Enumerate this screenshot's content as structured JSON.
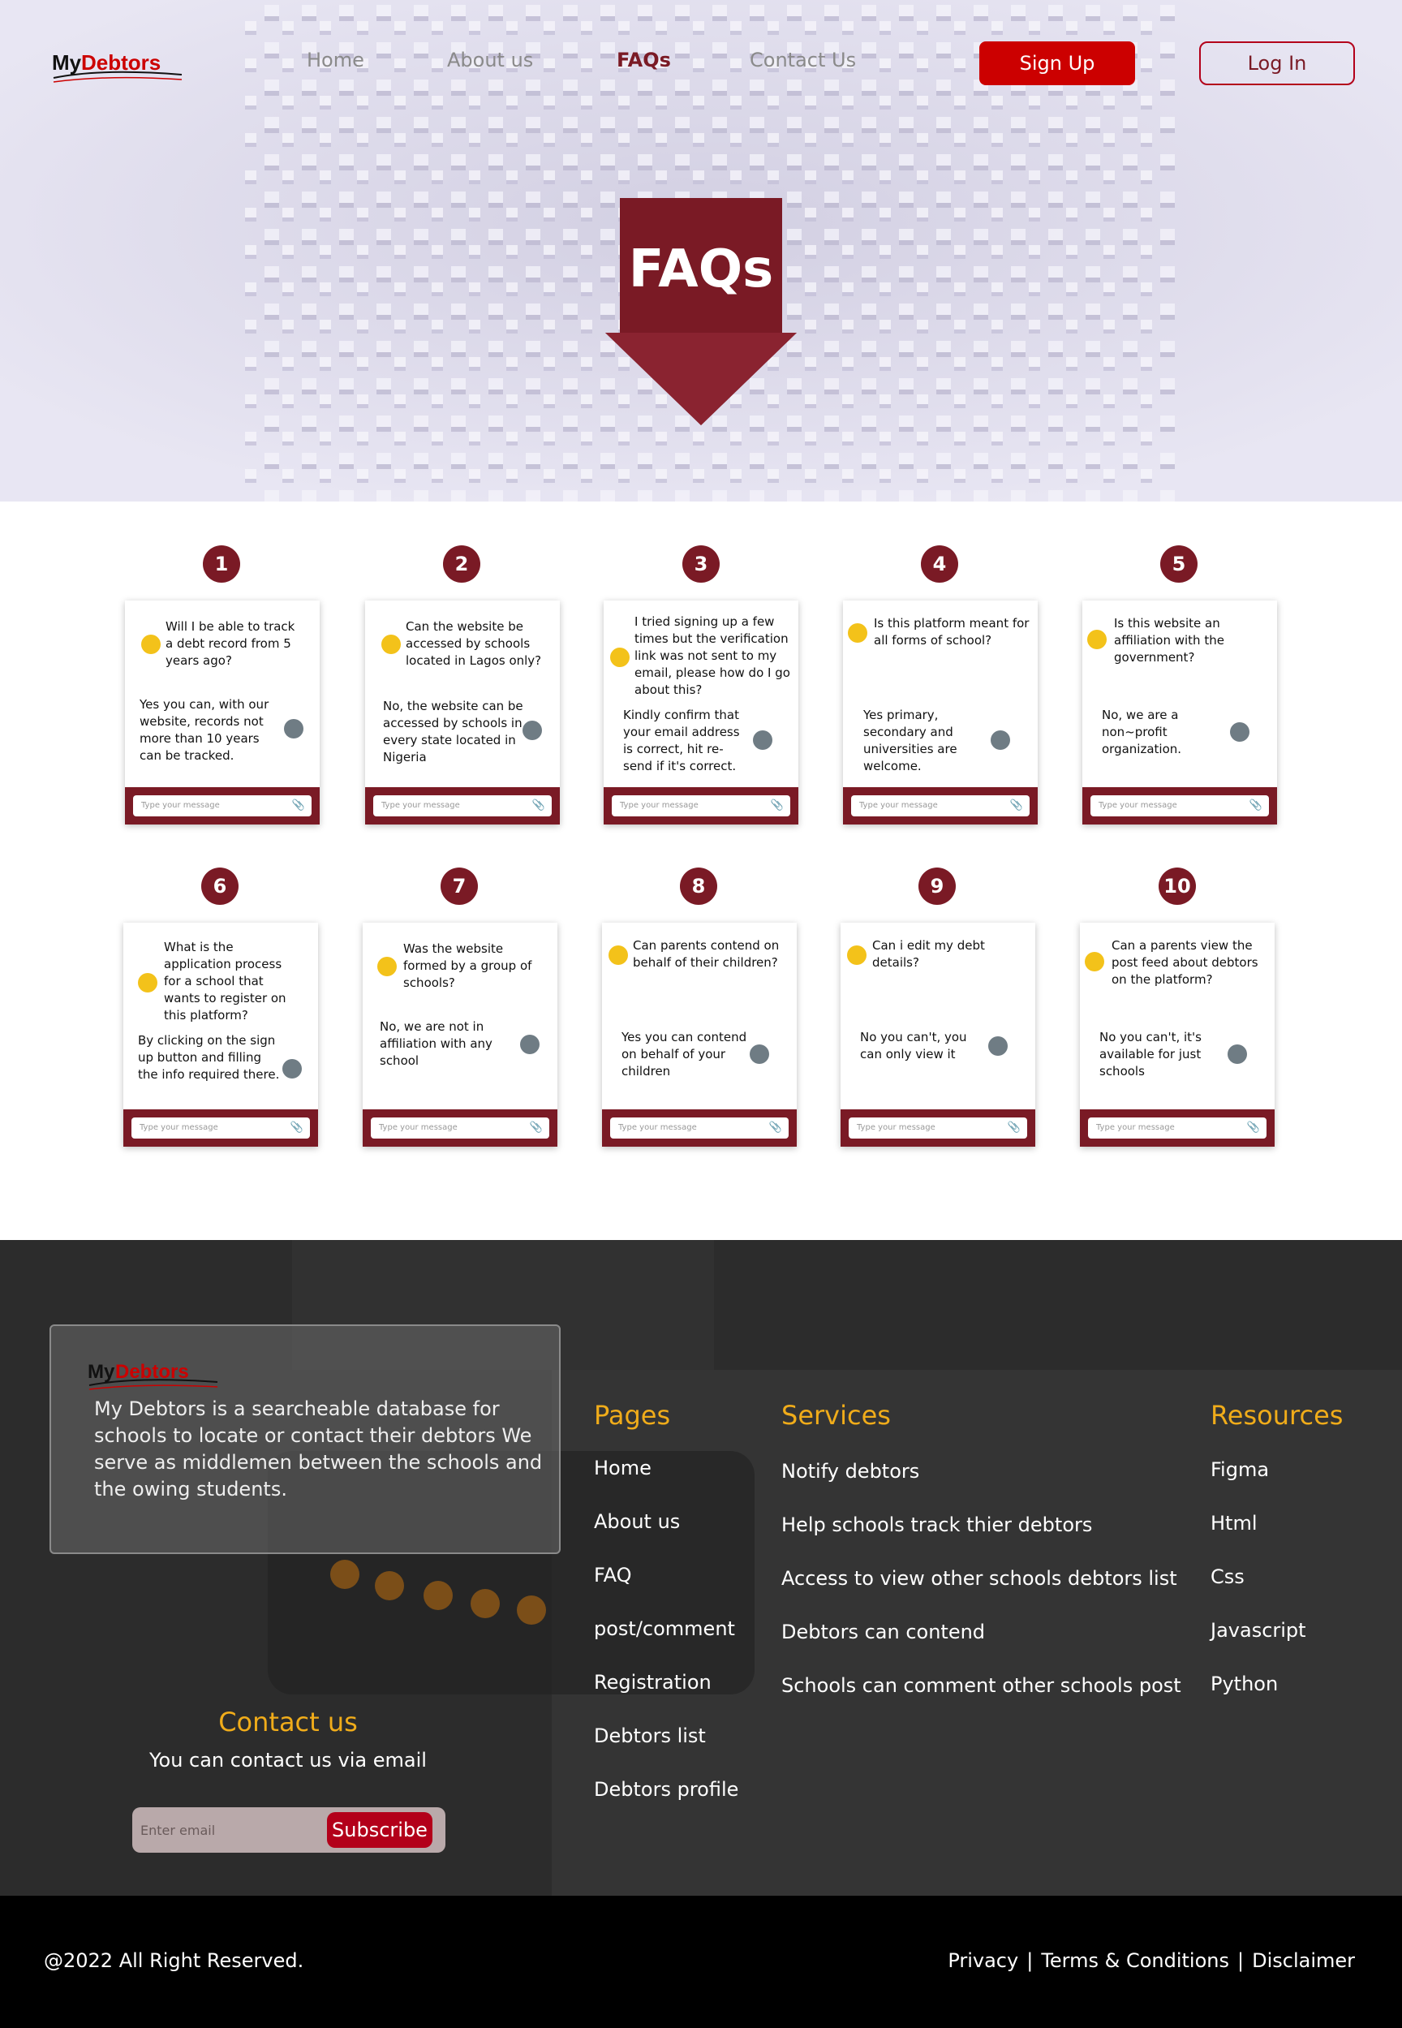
{
  "brand": {
    "name_part1": "My",
    "name_part2": "Debtors"
  },
  "nav": {
    "links": [
      "Home",
      "About us",
      "FAQs",
      "Contact Us"
    ],
    "active": "FAQs",
    "signup": "Sign Up",
    "login": "Log In"
  },
  "hero": {
    "title": "FAQs"
  },
  "faqs": [
    {
      "num": "1",
      "q": "Will I be able to track a debt record from 5 years ago?",
      "a": "Yes you can, with our website, records not more than 10 years can be tracked."
    },
    {
      "num": "2",
      "q": "Can the website be accessed by schools located in Lagos only?",
      "a": "No, the website can be accessed by schools in every state located in Nigeria"
    },
    {
      "num": "3",
      "q": "I tried signing up a few times but the verification link was not sent to my email, please how do I go about this?",
      "a": "Kindly confirm that your email address is correct, hit re-send if it's correct."
    },
    {
      "num": "4",
      "q": "Is this platform meant for all forms of school?",
      "a": "Yes primary, secondary and universities are welcome."
    },
    {
      "num": "5",
      "q": "Is this website an affiliation with the government?",
      "a": "No, we are a non~profit organization."
    },
    {
      "num": "6",
      "q": "What is the application process for a school that wants to register on this platform?",
      "a": "By clicking on the sign up button and filling the info required there."
    },
    {
      "num": "7",
      "q": "Was the website formed by a group of schools?",
      "a": "No, we are not in affiliation with any school"
    },
    {
      "num": "8",
      "q": "Can parents contend on behalf of their children?",
      "a": "Yes you can contend on behalf of your children"
    },
    {
      "num": "9",
      "q": "Can i edit my debt details?",
      "a": "No you can't, you can only view it"
    },
    {
      "num": "10",
      "q": "Can a parents view the post feed about debtors on the platform?",
      "a": "No you can't, it's available for just schools"
    }
  ],
  "message_placeholder": "Type your message",
  "footer": {
    "about": "My Debtors is a searcheable database for schools to locate or contact their debtors We serve as middlemen between the schools and the owing students.",
    "pages_title": "Pages",
    "pages": [
      "Home",
      "About us",
      "FAQ",
      "post/comment",
      "Registration",
      "Debtors list",
      "Debtors profile"
    ],
    "services_title": "Services",
    "services": [
      "Notify debtors",
      "Help schools track thier debtors",
      "Access to view other schools debtors list",
      "Debtors can contend",
      "Schools can comment other schools post"
    ],
    "resources_title": "Resources",
    "resources": [
      "Figma",
      "Html",
      "Css",
      "Javascript",
      "Python"
    ],
    "contact_title": "Contact us",
    "contact_sub": "You can contact us via email",
    "email_placeholder": "Enter email",
    "subscribe": "Subscribe"
  },
  "bottom": {
    "copyright": "@2022 All Right Reserved.",
    "privacy": "Privacy",
    "terms": "Terms & Conditions",
    "disclaimer": "Disclaimer",
    "separator": "|"
  },
  "colors": {
    "brand": "#7a1a25",
    "accent": "#cc0000",
    "gold": "#f0ac1a"
  }
}
